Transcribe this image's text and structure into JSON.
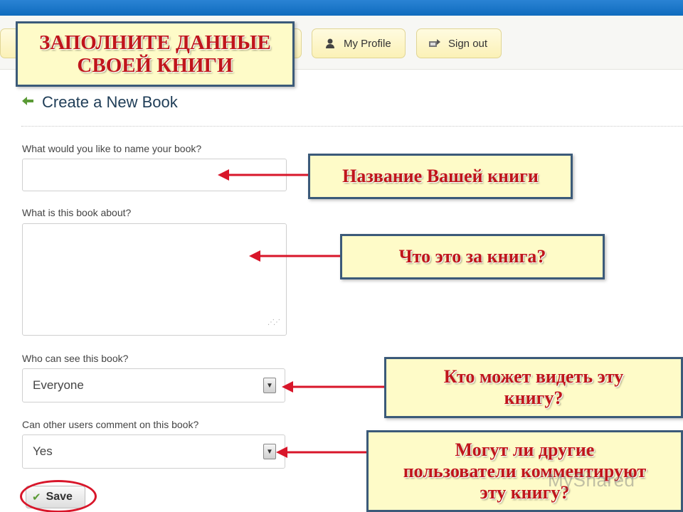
{
  "nav": {
    "profile_label": "My Profile",
    "signout_label": "Sign out"
  },
  "overlay": {
    "title_line1": "ЗАПОЛНИТЕ ДАННЫЕ",
    "title_line2": "СВОЕЙ КНИГИ",
    "name_note": "Название Вашей книги",
    "about_note": "Что это за книга?",
    "visibility_note_line1": "Кто может видеть эту",
    "visibility_note_line2": "книгу?",
    "comments_note_line1": "Могут ли другие",
    "comments_note_line2": "пользователи комментируют",
    "comments_note_line3": "эту книгу?"
  },
  "page": {
    "title": "Create a New Book"
  },
  "form": {
    "name_label": "What would you like to name your book?",
    "name_value": "",
    "about_label": "What is this book about?",
    "about_value": "",
    "visibility_label": "Who can see this book?",
    "visibility_value": "Everyone",
    "comments_label": "Can other users comment on this book?",
    "comments_value": "Yes",
    "save_label": "Save"
  },
  "watermark": "MyShared",
  "colors": {
    "header_blue": "#0f6bbd",
    "note_red": "#c0151b",
    "arrow_red": "#d8162a",
    "note_bg": "#fefbc8",
    "note_border": "#3b5a79"
  }
}
